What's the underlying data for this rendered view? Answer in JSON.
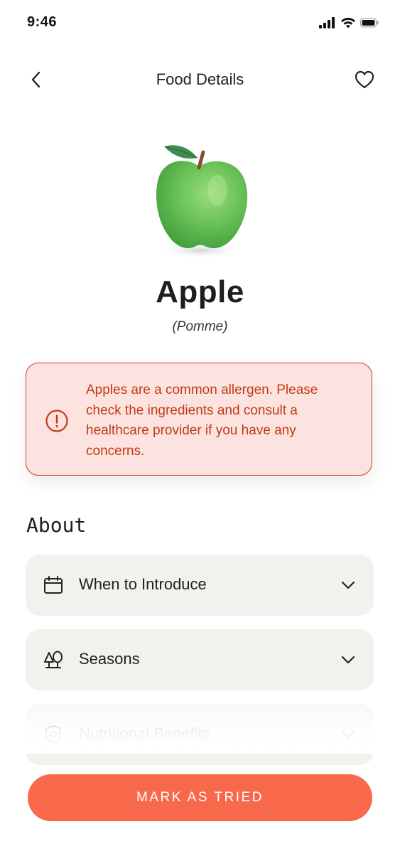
{
  "status_bar": {
    "time": "9:46",
    "icons": [
      "signal-icon",
      "wifi-icon",
      "battery-icon"
    ]
  },
  "nav": {
    "title": "Food Details",
    "back_icon": "chevron-left-icon",
    "favorite_icon": "heart-icon"
  },
  "food": {
    "name": "Apple",
    "alt_name": "(Pomme)",
    "image": "green-apple-illustration"
  },
  "alert": {
    "icon": "exclamation-circle-icon",
    "text": "Apples are a common allergen. Please check the ingredients and consult a healthcare provider if you have any concerns."
  },
  "about": {
    "title": "About",
    "items": [
      {
        "label": "When to Introduce",
        "icon": "calendar-icon"
      },
      {
        "label": "Seasons",
        "icon": "trees-icon"
      },
      {
        "label": "Nutritional Benefits",
        "icon": "shield-heart-icon"
      }
    ]
  },
  "cta": {
    "label": "MARK AS TRIED"
  },
  "colors": {
    "accent": "#f8694c",
    "alert_bg": "#fde3df",
    "alert_text": "#c23a15",
    "card_bg": "#f3f1ee"
  }
}
